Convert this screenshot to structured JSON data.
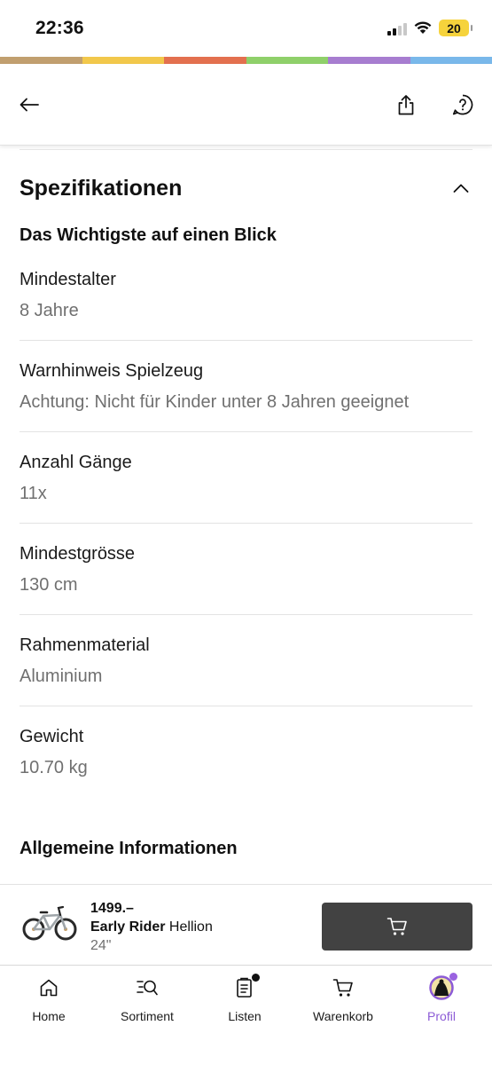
{
  "status_bar": {
    "time": "22:36",
    "battery": "20"
  },
  "brand_strip": [
    "#c19f6f",
    "#f2c84b",
    "#e3704f",
    "#8fd06a",
    "#a77dd0",
    "#79b8ea"
  ],
  "topnav": {
    "back_icon": "arrow-left-icon",
    "share_icon": "share-icon",
    "help_icon": "help-circle-icon"
  },
  "specs": {
    "title": "Spezifikationen",
    "subsection": "Das Wichtigste auf einen Blick",
    "items": [
      {
        "label": "Mindestalter",
        "value": "8 Jahre"
      },
      {
        "label": "Warnhinweis Spielzeug",
        "value": "Achtung: Nicht für Kinder unter 8 Jahren geeignet"
      },
      {
        "label": "Anzahl Gänge",
        "value": "11x"
      },
      {
        "label": "Mindestgrösse",
        "value": "130 cm"
      },
      {
        "label": "Rahmenmaterial",
        "value": "Aluminium"
      },
      {
        "label": "Gewicht",
        "value": "10.70 kg"
      }
    ],
    "general_title": "Allgemeine Informationen"
  },
  "product": {
    "price": "1499.–",
    "brand": "Early Rider",
    "name": " Hellion",
    "variant": "24\"",
    "cart_icon": "cart-icon"
  },
  "tabs": [
    {
      "label": "Home",
      "icon": "home-icon"
    },
    {
      "label": "Sortiment",
      "icon": "search-list-icon"
    },
    {
      "label": "Listen",
      "icon": "list-icon"
    },
    {
      "label": "Warenkorb",
      "icon": "cart-icon"
    },
    {
      "label": "Profil",
      "icon": "avatar-icon"
    }
  ],
  "colors": {
    "active_tab": "#8c5bd6",
    "cart_button": "#424242",
    "badge_dot": "#111111",
    "profile_dot": "#9a63e0"
  }
}
